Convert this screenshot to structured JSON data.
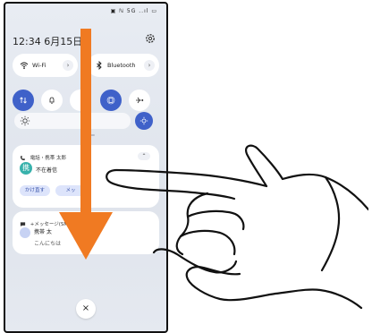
{
  "status_bar": {
    "icons": "▣ ℕ 5G ..ıl ▭"
  },
  "header": {
    "time": "12:34",
    "date": "6月15日("
  },
  "quick_tiles": {
    "wifi": {
      "label": "Wi-Fi",
      "chevron": "›"
    },
    "bluetooth": {
      "label": "Bluetooth",
      "chevron": "›"
    }
  },
  "notifications": {
    "call": {
      "header": "電話・携帯 太郎",
      "expand": "⌃",
      "avatar": "携",
      "text": "不在着信",
      "actions": [
        "かけ直す",
        "メッ"
      ]
    },
    "message": {
      "header": "+メッセージ(SM",
      "name": "携帯 太",
      "text": "こんにちは"
    }
  },
  "close_label": "×",
  "accent": "#3f61c9",
  "arrow_color": "#f07a22"
}
